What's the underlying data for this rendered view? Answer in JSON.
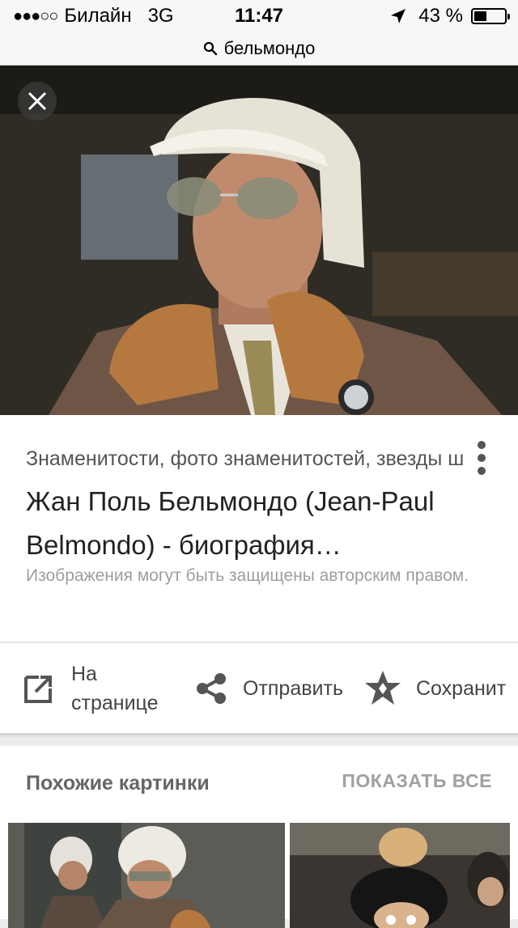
{
  "status_bar": {
    "signal": "●●●○○",
    "carrier": "Билайн",
    "network": "3G",
    "time": "11:47",
    "battery_percent": "43 %",
    "battery_level": 0.43
  },
  "url_bar": {
    "query": "бельмондо"
  },
  "image_viewer": {
    "source": "Знаменитости, фото знаменитостей, звезды ш",
    "title": "Жан Поль Бельмондо (Jean-Paul Belmondo) - биография…",
    "copyright_notice": "Изображения могут быть защищены авторским правом."
  },
  "actions": {
    "visit": "На странице",
    "share": "Отправить",
    "save": "Сохранит"
  },
  "similar": {
    "title": "Похожие картинки",
    "show_all": "ПОКАЗАТЬ ВСЕ"
  },
  "colors": {
    "accent": "#000000",
    "text_secondary": "#9e9e9e"
  },
  "icons": [
    "search-icon",
    "location-arrow-icon",
    "battery-icon",
    "close-icon",
    "more-vert-icon",
    "open-in-new-icon",
    "share-icon",
    "star-icon"
  ]
}
